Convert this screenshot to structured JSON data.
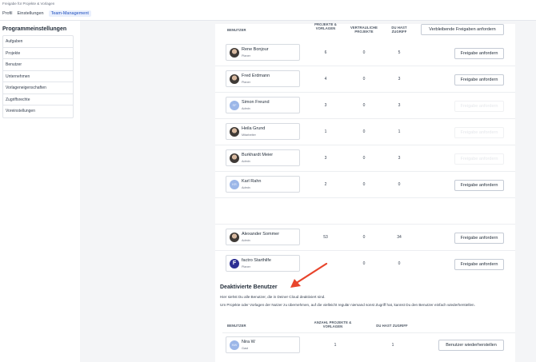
{
  "breadcrumb": "Freigabe für Projekte & Vorlagen",
  "tabs": [
    {
      "label": "Profil",
      "active": false
    },
    {
      "label": "Einstellungen",
      "active": false
    },
    {
      "label": "Team-Management",
      "active": true
    }
  ],
  "sidebar": {
    "title": "Programmeinstellungen",
    "items": [
      "Aufgaben",
      "Projekte",
      "Benutzer",
      "Unternehmen",
      "Vorlageneigenschaften",
      "Zugriffsrechte",
      "Voreinstellungen"
    ]
  },
  "users_table": {
    "headers": {
      "user": "BENUTZER",
      "projects": "PROJEKTE & VORLAGEN",
      "confidential": "VERTRAULICHE PROJEKTE",
      "access": "DU HAST ZUGRIFF"
    },
    "request_remaining_label": "Verbleibende Freigaben anfordern",
    "rows": [
      {
        "name": "Rene Bonjour",
        "role": "Planer",
        "projects": "6",
        "confidential": "0",
        "access": "5",
        "button": "Freigabe anfordern",
        "button_enabled": true,
        "avatar": "photo",
        "initials": ""
      },
      {
        "name": "Fred Erdmann",
        "role": "Planer",
        "projects": "4",
        "confidential": "0",
        "access": "3",
        "button": "Freigabe anfordern",
        "button_enabled": true,
        "avatar": "photo",
        "initials": ""
      },
      {
        "name": "Simon Freund",
        "role": "Admin",
        "projects": "3",
        "confidential": "0",
        "access": "3",
        "button": "Freigabe anfordern",
        "button_enabled": false,
        "avatar": "initials",
        "initials": "SF"
      },
      {
        "name": "Heila Grund",
        "role": "Mitarbeiter",
        "projects": "1",
        "confidential": "0",
        "access": "1",
        "button": "Freigabe anfordern",
        "button_enabled": false,
        "avatar": "photo",
        "initials": ""
      },
      {
        "name": "Burkhardt Meier",
        "role": "Admin",
        "projects": "3",
        "confidential": "0",
        "access": "3",
        "button": "Freigabe anfordern",
        "button_enabled": false,
        "avatar": "photo",
        "initials": ""
      },
      {
        "name": "Karl Rahn",
        "role": "Admin",
        "projects": "2",
        "confidential": "0",
        "access": "0",
        "button": "Freigabe anfordern",
        "button_enabled": true,
        "avatar": "initials",
        "initials": "KR"
      },
      {
        "name": "Alexander Sommer",
        "role": "Admin",
        "projects": "53",
        "confidential": "0",
        "access": "34",
        "button": "Freigabe anfordern",
        "button_enabled": true,
        "avatar": "photo",
        "initials": ""
      },
      {
        "name": "factro Starthilfe",
        "role": "Planer",
        "projects": "",
        "confidential": "0",
        "access": "0",
        "button": "Freigabe anfordern",
        "button_enabled": true,
        "avatar": "logo",
        "initials": "F"
      }
    ]
  },
  "deactivated": {
    "title": "Deaktivierte Benutzer",
    "text1": "Hier siehst Du alle Benutzer, die in Deiner Cloud deaktiviert sind.",
    "text2": "Um Projekte oder Vorlagen der Nutzer zu übernehmen, auf die vielleicht regulär niemand sonst Zugriff hat, kannst Du den Benutzer einfach wiederherstellen.",
    "headers": {
      "user": "BENUTZER",
      "projects": "ANZAHL PROJEKTE & VORLAGEN",
      "access": "DU HAST ZUGRIFF"
    },
    "rows": [
      {
        "name": "Nira W",
        "role": "Gast",
        "projects": "1",
        "access": "1",
        "button": "Benutzer wiederherstellen",
        "initials": "NW"
      }
    ]
  },
  "colors": {
    "accent": "#1e4fbf",
    "arrow": "#e8452c"
  }
}
